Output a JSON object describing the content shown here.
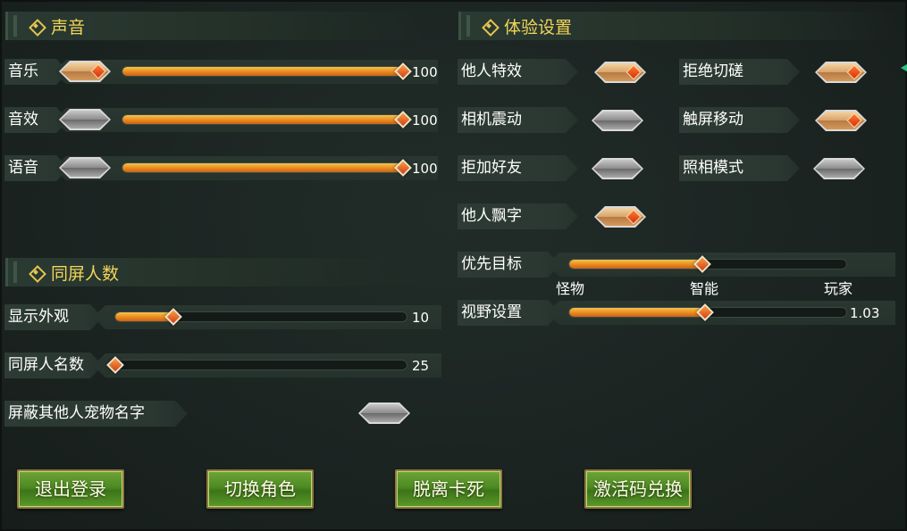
{
  "sections": {
    "sound": {
      "title": "声音",
      "rows": [
        {
          "label": "音乐",
          "toggle": "on",
          "value": 100,
          "value_text": "100"
        },
        {
          "label": "音效",
          "toggle": "off",
          "value": 100,
          "value_text": "100"
        },
        {
          "label": "语音",
          "toggle": "off",
          "value": 100,
          "value_text": "100"
        }
      ]
    },
    "screen_people": {
      "title": "同屏人数",
      "rows": [
        {
          "label": "显示外观",
          "value_text": "10",
          "level": 0.2
        },
        {
          "label": "同屏人名数",
          "value_text": "25",
          "level": 0.0
        }
      ],
      "hide_pet_names": {
        "label": "屏蔽其他人宠物名字",
        "toggle": "off"
      }
    },
    "experience": {
      "title": "体验设置",
      "toggles": [
        {
          "label": "他人特效",
          "state": "on"
        },
        {
          "label": "拒绝切磋",
          "state": "on"
        },
        {
          "label": "相机震动",
          "state": "off"
        },
        {
          "label": "触屏移动",
          "state": "on"
        },
        {
          "label": "拒加好友",
          "state": "off"
        },
        {
          "label": "照相模式",
          "state": "off"
        },
        {
          "label": "他人飘字",
          "state": "on"
        }
      ],
      "priority_target": {
        "label": "优先目标",
        "options": [
          "怪物",
          "智能",
          "玩家"
        ],
        "selected": "智能",
        "level": 0.5
      },
      "view_setting": {
        "label": "视野设置",
        "value_text": "1.03",
        "level": 0.5
      }
    }
  },
  "buttons": {
    "logout": "退出登录",
    "switch_role": "切换角色",
    "unstuck": "脱离卡死",
    "redeem_code": "激活码兑换"
  },
  "colors": {
    "header_text": "#f1d55a",
    "slider_fill": "#e98a1d",
    "button_green": "#4c8a22",
    "background": "#1d2623"
  }
}
